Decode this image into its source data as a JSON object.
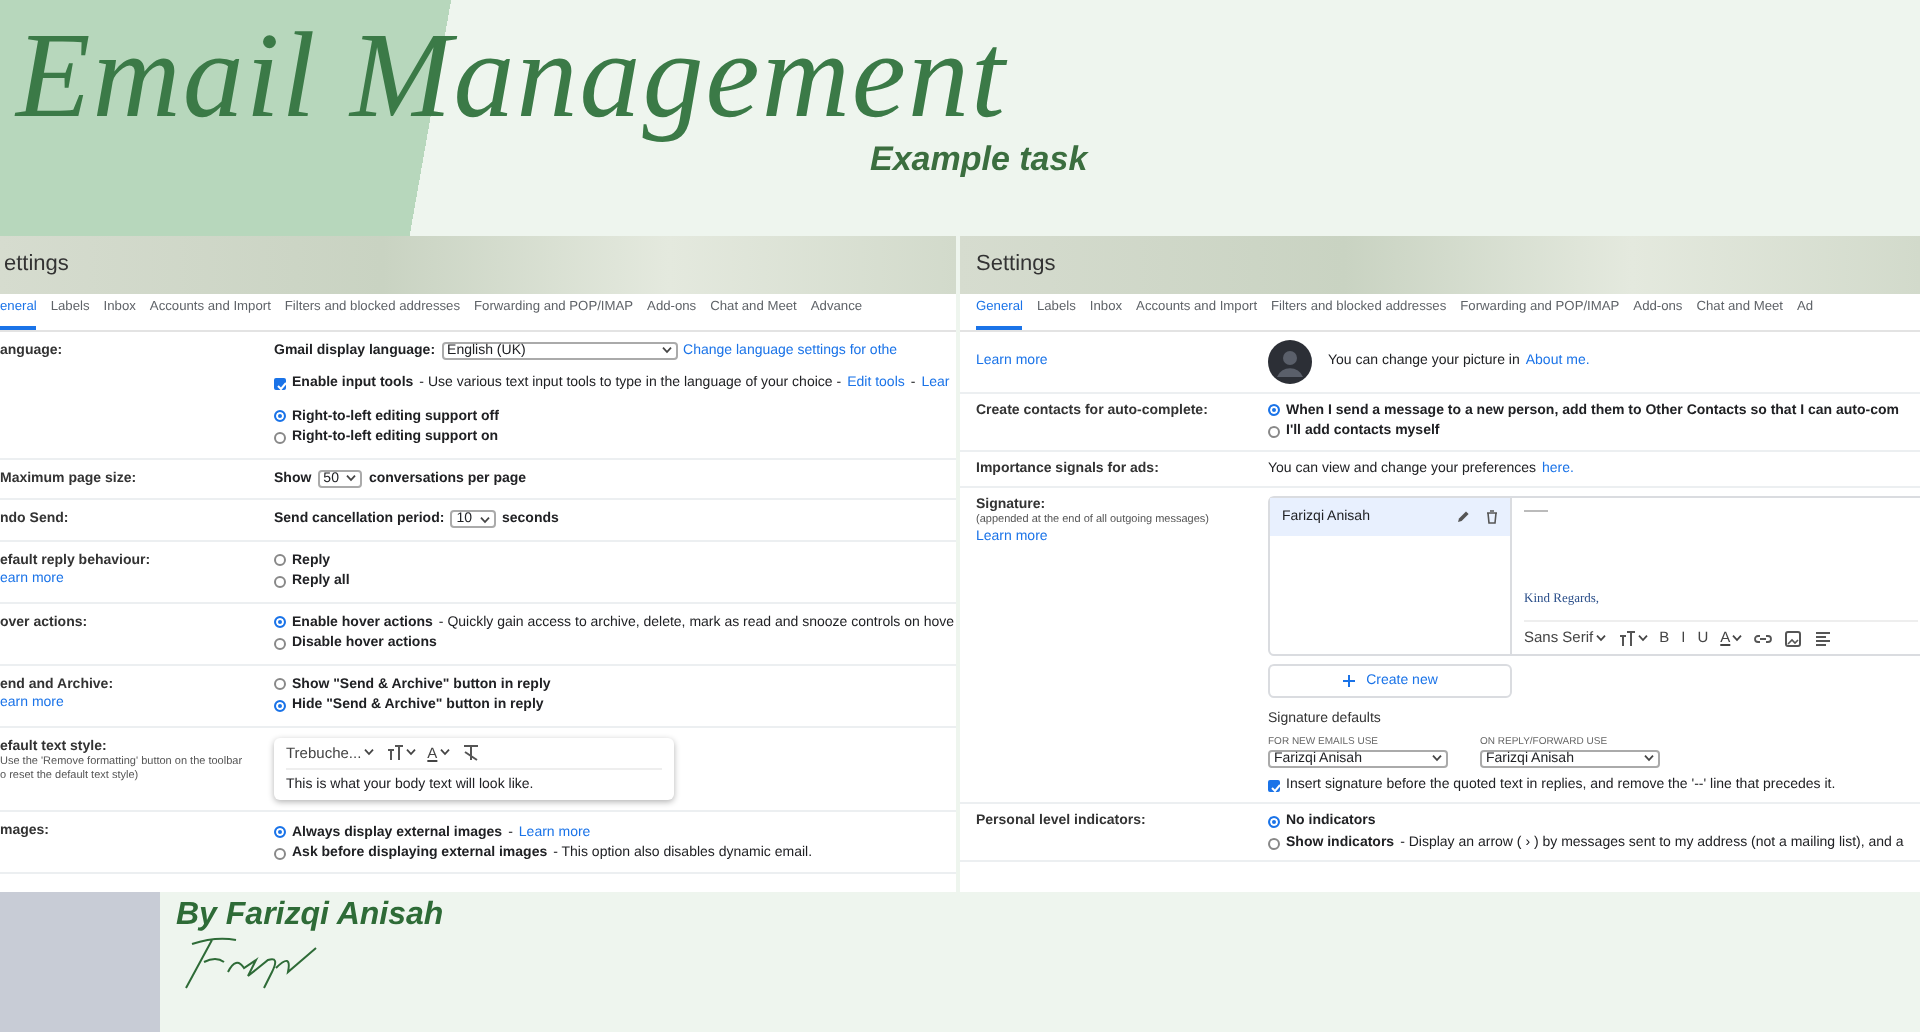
{
  "title": "Email Management",
  "subtitle": "Example task",
  "panels": [
    {
      "heading": "ettings",
      "tabs": [
        {
          "label": "eneral",
          "selected": true
        },
        {
          "label": "Labels",
          "selected": false
        },
        {
          "label": "Inbox",
          "selected": false
        },
        {
          "label": "Accounts and Import",
          "selected": false
        },
        {
          "label": "Filters and blocked addresses",
          "selected": false
        },
        {
          "label": "Forwarding and POP/IMAP",
          "selected": false
        },
        {
          "label": "Add-ons",
          "selected": false
        },
        {
          "label": "Chat and Meet",
          "selected": false
        },
        {
          "label": "Advance",
          "selected": false
        }
      ],
      "rows": [
        {
          "kind": "options",
          "label": "anguage:",
          "options": [
            {
              "kind": "plain",
              "tail": [
                {
                  "kind": "strong",
                  "text": "Gmail display language:"
                },
                {
                  "kind": "select",
                  "text": "English (UK)"
                },
                {
                  "kind": "link",
                  "text": "Change language settings for othe"
                }
              ]
            },
            {
              "kind": "checkbox",
              "checked": true,
              "label": "Enable input tools",
              "tail": [
                {
                  "kind": "text",
                  "text": "- Use various text input tools to type in the language of your choice -"
                },
                {
                  "kind": "link",
                  "text": "Edit tools"
                },
                {
                  "kind": "text",
                  "text": "-"
                },
                {
                  "kind": "link",
                  "text": "Lear"
                }
              ]
            },
            {
              "kind": "radio",
              "selected": true,
              "label": "Right-to-left editing support off"
            },
            {
              "kind": "radio",
              "selected": false,
              "label": "Right-to-left editing support on"
            }
          ]
        },
        {
          "kind": "options",
          "label": "Maximum page size:",
          "options": [
            {
              "kind": "plain",
              "tail": [
                {
                  "kind": "strong",
                  "text": "Show"
                },
                {
                  "kind": "select",
                  "text": "50"
                },
                {
                  "kind": "strong",
                  "text": "conversations per page"
                }
              ]
            }
          ]
        },
        {
          "kind": "options",
          "label": "ndo Send:",
          "options": [
            {
              "kind": "plain",
              "tail": [
                {
                  "kind": "strong",
                  "text": "Send cancellation period:"
                },
                {
                  "kind": "select",
                  "text": "10"
                },
                {
                  "kind": "strong",
                  "text": "seconds"
                }
              ]
            }
          ]
        },
        {
          "kind": "options",
          "label": "efault reply behaviour:",
          "link": "earn more",
          "options": [
            {
              "kind": "radio",
              "selected": false,
              "label": "Reply"
            },
            {
              "kind": "radio",
              "selected": false,
              "label": "Reply all"
            }
          ]
        },
        {
          "kind": "options",
          "label": "over actions:",
          "options": [
            {
              "kind": "radio",
              "selected": true,
              "label": "Enable hover actions",
              "tail": [
                {
                  "kind": "text",
                  "text": "- Quickly gain access to archive, delete, mark as read and snooze controls on hove"
                }
              ]
            },
            {
              "kind": "radio",
              "selected": false,
              "label": "Disable hover actions"
            }
          ]
        },
        {
          "kind": "options",
          "label": "end and Archive:",
          "link": "earn more",
          "options": [
            {
              "kind": "radio",
              "selected": false,
              "label": "Show \"Send & Archive\" button in reply"
            },
            {
              "kind": "radio",
              "selected": true,
              "label": "Hide \"Send & Archive\" button in reply"
            }
          ]
        },
        {
          "kind": "stylebox",
          "label": "efault text style:",
          "notes": [
            "Use the 'Remove formatting' button on the toolbar",
            "o reset the default text style)"
          ],
          "font": "Trebuche...",
          "color_button": "A",
          "sample": "This is what your body text will look like."
        },
        {
          "kind": "options",
          "label": "mages:",
          "options": [
            {
              "kind": "radio",
              "selected": true,
              "label": "Always display external images",
              "tail": [
                {
                  "kind": "text",
                  "text": "-"
                },
                {
                  "kind": "link",
                  "text": "Learn more"
                }
              ]
            },
            {
              "kind": "radio",
              "selected": false,
              "label": "Ask before displaying external images",
              "tail": [
                {
                  "kind": "text",
                  "text": "- This option also disables dynamic email."
                }
              ]
            }
          ]
        }
      ]
    },
    {
      "heading": "Settings",
      "tabs": [
        {
          "label": "General",
          "selected": true
        },
        {
          "label": "Labels",
          "selected": false
        },
        {
          "label": "Inbox",
          "selected": false
        },
        {
          "label": "Accounts and Import",
          "selected": false
        },
        {
          "label": "Filters and blocked addresses",
          "selected": false
        },
        {
          "label": "Forwarding and POP/IMAP",
          "selected": false
        },
        {
          "label": "Add-ons",
          "selected": false
        },
        {
          "label": "Chat and Meet",
          "selected": false
        },
        {
          "label": "Ad",
          "selected": false
        }
      ],
      "rows": [
        {
          "kind": "profile",
          "link": "Learn more",
          "options": [
            {
              "kind": "plain",
              "tail": [
                {
                  "kind": "text",
                  "text": "You can change your picture in"
                },
                {
                  "kind": "link",
                  "text": "About me."
                }
              ]
            }
          ]
        },
        {
          "kind": "options",
          "label": "Create contacts for auto-complete:",
          "options": [
            {
              "kind": "radio",
              "selected": true,
              "label": "When I send a message to a new person, add them to Other Contacts so that I can auto-com"
            },
            {
              "kind": "radio",
              "selected": false,
              "label": "I'll add contacts myself"
            }
          ]
        },
        {
          "kind": "options",
          "label": "Importance signals for ads:",
          "options": [
            {
              "kind": "plain",
              "tail": [
                {
                  "kind": "text",
                  "text": "You can view and change your preferences"
                },
                {
                  "kind": "link",
                  "text": "here."
                }
              ]
            }
          ]
        },
        {
          "kind": "signature",
          "label": "Signature:",
          "notes": [
            "(appended at the end of all outgoing messages)"
          ],
          "link": "Learn more",
          "items": [
            {
              "name": "Farizqi Anisah",
              "selected": true
            }
          ],
          "body": "Kind Regards,",
          "font": "Sans Serif",
          "buttons": [
            "B",
            "I",
            "U",
            "A"
          ],
          "create": "Create new",
          "defaults_title": "Signature defaults",
          "defaults": [
            {
              "caption": "FOR NEW EMAILS USE",
              "value": "Farizqi Anisah"
            },
            {
              "caption": "ON REPLY/FORWARD USE",
              "value": "Farizqi Anisah"
            }
          ],
          "insert": {
            "checked": true,
            "text": "Insert signature before the quoted text in replies, and remove the '--' line that precedes it."
          }
        },
        {
          "kind": "options",
          "label": "Personal level indicators:",
          "options": [
            {
              "kind": "radio",
              "selected": true,
              "label": "No indicators"
            },
            {
              "kind": "radio",
              "selected": false,
              "label": "Show indicators",
              "tail": [
                {
                  "kind": "text",
                  "text": "- Display an arrow ( › ) by messages sent to my address (not a mailing list), and a"
                }
              ]
            }
          ]
        }
      ]
    }
  ],
  "byline": "By Farizqi Anisah"
}
